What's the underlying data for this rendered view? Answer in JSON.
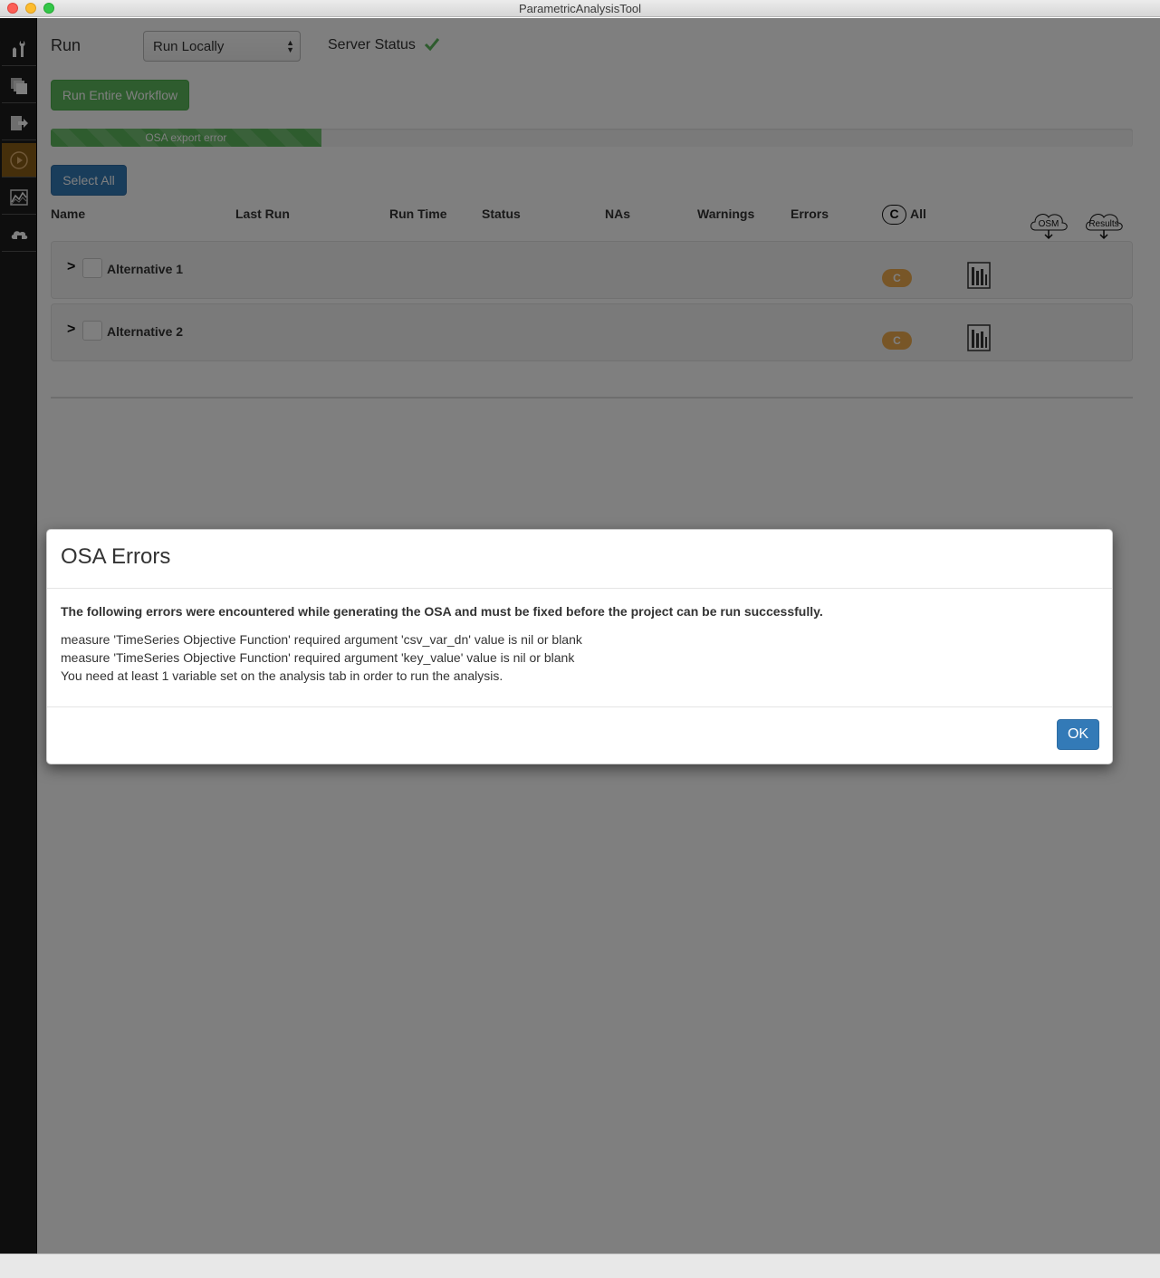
{
  "window": {
    "title": "ParametricAnalysisTool"
  },
  "sidebar": {
    "items": [
      {
        "icon": "tools-icon"
      },
      {
        "icon": "measures-icon"
      },
      {
        "icon": "export-icon"
      },
      {
        "icon": "run-icon",
        "active": true
      },
      {
        "icon": "results-icon"
      },
      {
        "icon": "server-cloud-icon"
      }
    ]
  },
  "run": {
    "label": "Run",
    "mode_select": {
      "value": "Run Locally"
    },
    "server_status_label": "Server Status",
    "server_status_ok": true,
    "run_workflow_label": "Run Entire Workflow",
    "progress": {
      "text": "OSA export error",
      "fraction": 0.25
    },
    "select_all_label": "Select All"
  },
  "table": {
    "columns": [
      "Name",
      "Last Run",
      "Run Time",
      "Status",
      "NAs",
      "Warnings",
      "Errors"
    ],
    "c_toggle_label": "C",
    "all_label": "All",
    "osm_download_label": "OSM",
    "results_download_label": "Results",
    "rows": [
      {
        "name": "Alternative 1",
        "badge": "C"
      },
      {
        "name": "Alternative 2",
        "badge": "C"
      }
    ]
  },
  "modal": {
    "title": "OSA Errors",
    "intro": "The following errors were encountered while generating the OSA and must be fixed before the project can be run successfully.",
    "errors": [
      "measure 'TimeSeries Objective Function' required argument 'csv_var_dn' value is nil or blank",
      "measure 'TimeSeries Objective Function' required argument 'key_value' value is nil or blank",
      "You need at least 1 variable set on the analysis tab in order to run the analysis."
    ],
    "ok_label": "OK"
  },
  "colors": {
    "sidebar_bg": "#1d1d1d",
    "active_nav": "#8a5f17",
    "success_green": "#5cb85c",
    "primary_blue": "#337ab7",
    "warning_orange": "#f0ad4e"
  }
}
